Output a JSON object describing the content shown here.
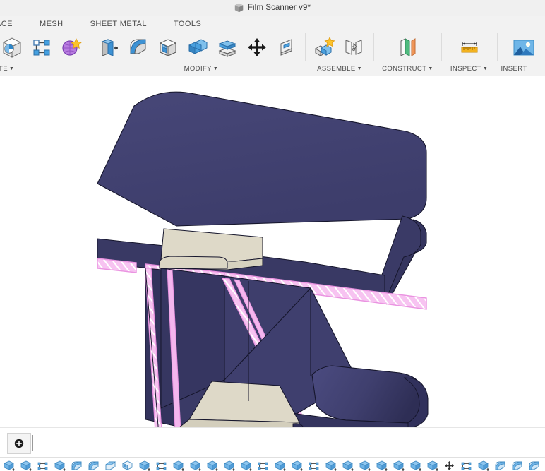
{
  "window": {
    "title": "Film Scanner v9*",
    "doc_icon": "cube-icon"
  },
  "ribbon": {
    "tabs": [
      {
        "label": "ACE",
        "truncated": true
      },
      {
        "label": "MESH"
      },
      {
        "label": "SHEET METAL"
      },
      {
        "label": "TOOLS"
      }
    ],
    "panels": [
      {
        "label": "ATE",
        "truncated": true,
        "has_dropdown": true,
        "buttons": [
          {
            "icon": "create-sketch-icon"
          },
          {
            "icon": "create-sketch-dimension-icon"
          },
          {
            "icon": "create-form-icon"
          }
        ]
      },
      {
        "label": "MODIFY",
        "has_dropdown": true,
        "buttons": [
          {
            "icon": "press-pull-icon"
          },
          {
            "icon": "fillet-icon"
          },
          {
            "icon": "shell-icon"
          },
          {
            "icon": "combine-icon"
          },
          {
            "icon": "offset-face-icon"
          },
          {
            "icon": "move-copy-icon"
          },
          {
            "icon": "align-icon"
          }
        ]
      },
      {
        "label": "ASSEMBLE",
        "has_dropdown": true,
        "buttons": [
          {
            "icon": "new-component-icon"
          },
          {
            "icon": "joint-icon"
          }
        ]
      },
      {
        "label": "CONSTRUCT",
        "has_dropdown": true,
        "buttons": [
          {
            "icon": "offset-plane-icon"
          }
        ]
      },
      {
        "label": "INSPECT",
        "has_dropdown": true,
        "buttons": [
          {
            "icon": "measure-icon"
          }
        ]
      },
      {
        "label": "INSERT",
        "has_dropdown": false,
        "buttons": [
          {
            "icon": "insert-image-icon"
          }
        ]
      }
    ]
  },
  "canvas": {
    "model_name": "film-scanner-section-view",
    "colors": {
      "body_navy": "#414170",
      "body_navy_dark": "#31315c",
      "body_navy_darker": "#2b2b52",
      "body_navy_light": "#4a4a7d",
      "section_pink": "#f4b6ee",
      "section_pink_line": "#e98fe0",
      "face_beige": "#ded9c8",
      "face_beige_dark": "#cfcab7",
      "edge": "#14142a",
      "background": "#ffffff"
    }
  },
  "timeline": {
    "start_marker_icon": "timeline-start-icon",
    "playhead": "timeline-playhead",
    "features": [
      {
        "icon": "extrude-icon"
      },
      {
        "icon": "extrude-icon"
      },
      {
        "icon": "sketch-icon"
      },
      {
        "icon": "extrude-icon"
      },
      {
        "icon": "fillet-icon"
      },
      {
        "icon": "fillet-icon"
      },
      {
        "icon": "chamfer-icon"
      },
      {
        "icon": "shell-icon"
      },
      {
        "icon": "extrude-icon"
      },
      {
        "icon": "sketch-icon"
      },
      {
        "icon": "extrude-icon"
      },
      {
        "icon": "extrude-icon"
      },
      {
        "icon": "extrude-icon"
      },
      {
        "icon": "extrude-icon"
      },
      {
        "icon": "extrude-icon"
      },
      {
        "icon": "sketch-icon"
      },
      {
        "icon": "extrude-icon"
      },
      {
        "icon": "extrude-icon"
      },
      {
        "icon": "sketch-icon"
      },
      {
        "icon": "extrude-icon"
      },
      {
        "icon": "extrude-icon"
      },
      {
        "icon": "extrude-icon"
      },
      {
        "icon": "extrude-icon"
      },
      {
        "icon": "extrude-icon"
      },
      {
        "icon": "extrude-icon"
      },
      {
        "icon": "extrude-icon"
      },
      {
        "icon": "move-icon"
      },
      {
        "icon": "sketch-icon"
      },
      {
        "icon": "extrude-icon"
      },
      {
        "icon": "fillet-icon"
      },
      {
        "icon": "fillet-icon"
      },
      {
        "icon": "fillet-icon"
      }
    ]
  }
}
